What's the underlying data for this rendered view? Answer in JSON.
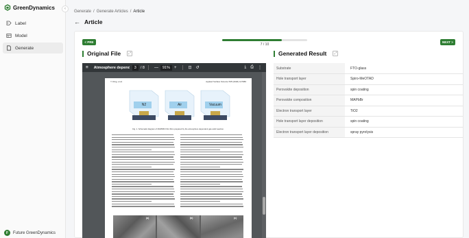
{
  "app": {
    "brand": "GreenDynamics",
    "collapse_icon": "chevron-left-icon",
    "accent": "#2e7d32"
  },
  "sidebar": {
    "items": [
      {
        "label": "Label",
        "icon": "label-tag-icon",
        "active": false
      },
      {
        "label": "Model",
        "icon": "model-grid-icon",
        "active": false
      },
      {
        "label": "Generate",
        "icon": "document-icon",
        "active": true
      }
    ],
    "user": {
      "initial": "F",
      "name": "Future GreenDynamics"
    }
  },
  "header": {
    "breadcrumb": [
      "Generate",
      "Generate Articles",
      "Article"
    ],
    "breadcrumb_sep": "/",
    "title": "Article"
  },
  "nav": {
    "prev_label": "< PRE",
    "next_label": "NEXT >",
    "progress_text": "7 / 10",
    "progress_fraction": 0.7
  },
  "original": {
    "title": "Original File",
    "viewer": {
      "doc_title": "Atmosphere depend...",
      "page_current": "3",
      "page_total": "/ 8",
      "zoom": "91%",
      "zoom_out": "—",
      "zoom_in": "+"
    },
    "page": {
      "header_left": "Y. Ding, et al.",
      "header_right": "Applied Surface Science 535 (2020) 147680",
      "fig_labels": [
        "N2",
        "Air",
        "Vacuum"
      ],
      "caption": "Fig. 1. Schematic diagram of MAPbBr3 thin films prepared by the atmosphere dependent gas-solid reaction.",
      "sem_labels": [
        "(a)",
        "(b)",
        "(c)"
      ]
    }
  },
  "result": {
    "title": "Generated Result",
    "rows": [
      {
        "key": "Substrate",
        "value": "FTO-glass"
      },
      {
        "key": "Hole transport layer",
        "value": "Spiro-MeOTAD"
      },
      {
        "key": "Perovskite deposition",
        "value": "spin coating"
      },
      {
        "key": "Perovskite composition",
        "value": "MAPbBr"
      },
      {
        "key": "Electron transport layer",
        "value": "TiO2"
      },
      {
        "key": "Hole transport layer deposition",
        "value": "spin coating"
      },
      {
        "key": "Electron transport layer deposition",
        "value": "spray pyrolysis"
      }
    ]
  }
}
